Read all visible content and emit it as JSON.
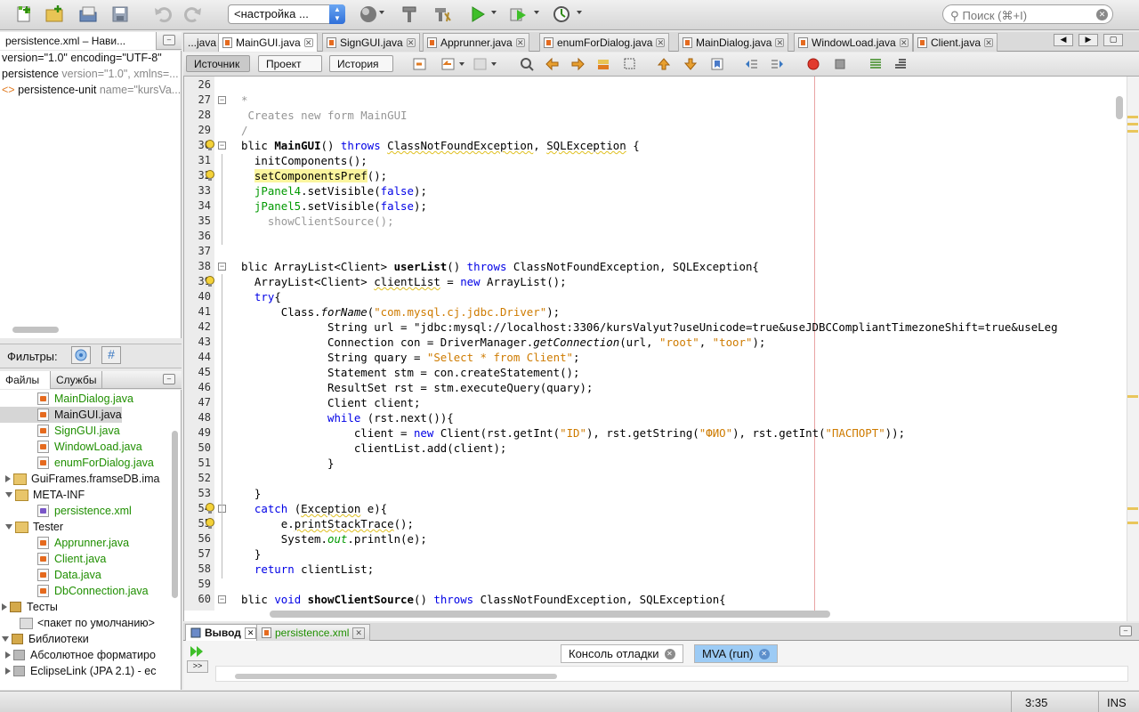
{
  "toolbar": {
    "config_label": "<настройка ...",
    "search_placeholder": "Поиск (⌘+I)",
    "icons": [
      "new-file-icon",
      "new-project-icon",
      "open-project-icon",
      "save-all-icon",
      "undo-icon",
      "redo-icon",
      "globe-icon",
      "hammer-icon",
      "clean-build-icon",
      "run-icon",
      "debug-icon",
      "profile-icon"
    ]
  },
  "navigator": {
    "title": "persistence.xml – Нави...",
    "lines": [
      {
        "text": "version=\"1.0\" encoding=\"UTF-8\"",
        "attr": ""
      },
      {
        "text": "persistence",
        "attr": " version=\"1.0\", xmlns=..."
      },
      {
        "text": "persistence-unit",
        "attr": " name=\"kursVa..."
      }
    ]
  },
  "filters": {
    "label": "Фильтры:"
  },
  "files_panel": {
    "tabs": [
      "Файлы",
      "Службы"
    ],
    "rows": [
      {
        "label": "MainDialog.java",
        "kind": "java",
        "indent": 42,
        "green": true
      },
      {
        "label": "MainGUI.java",
        "kind": "java",
        "indent": 42,
        "green": false,
        "selected": true
      },
      {
        "label": "SignGUI.java",
        "kind": "java",
        "indent": 42,
        "green": true
      },
      {
        "label": "WindowLoad.java",
        "kind": "java",
        "indent": 42,
        "green": true
      },
      {
        "label": "enumForDialog.java",
        "kind": "java",
        "indent": 42,
        "green": true
      },
      {
        "label": "GuiFrames.framseDB.ima",
        "kind": "package",
        "indent": 4,
        "green": false,
        "toggle": "closed"
      },
      {
        "label": "META-INF",
        "kind": "package",
        "indent": 4,
        "green": false,
        "toggle": "open"
      },
      {
        "label": "persistence.xml",
        "kind": "xml",
        "indent": 42,
        "green": true
      },
      {
        "label": "Tester",
        "kind": "package",
        "indent": 4,
        "green": false,
        "toggle": "open"
      },
      {
        "label": "Apprunner.java",
        "kind": "java",
        "indent": 42,
        "green": true
      },
      {
        "label": "Client.java",
        "kind": "java",
        "indent": 42,
        "green": true
      },
      {
        "label": "Data.java",
        "kind": "java",
        "indent": 42,
        "green": true
      },
      {
        "label": "DbConnection.java",
        "kind": "java",
        "indent": 42,
        "green": true
      },
      {
        "label": "Тесты",
        "kind": "folder",
        "indent": 0,
        "green": false,
        "toggle": "closed"
      },
      {
        "label": "<пакет по умолчанию>",
        "kind": "package-empty",
        "indent": 22,
        "green": false
      },
      {
        "label": "Библиотеки",
        "kind": "folder",
        "indent": 0,
        "green": false,
        "toggle": "open"
      },
      {
        "label": "Абсолютное форматиро",
        "kind": "lib",
        "indent": 4,
        "green": false,
        "toggle": "closed"
      },
      {
        "label": "EclipseLink (JPA 2.1) - ec",
        "kind": "lib",
        "indent": 4,
        "green": false,
        "toggle": "closed"
      }
    ]
  },
  "editor": {
    "tabs": [
      {
        "label": "...java",
        "active": false
      },
      {
        "label": "MainGUI.java",
        "active": true
      },
      {
        "label": "SignGUI.java",
        "active": false
      },
      {
        "label": "Apprunner.java",
        "active": false
      },
      {
        "label": "enumForDialog.java",
        "active": false
      },
      {
        "label": "MainDialog.java",
        "active": false
      },
      {
        "label": "WindowLoad.java",
        "active": false
      },
      {
        "label": "Client.java",
        "active": false
      }
    ],
    "views": [
      "Источник",
      "Проект",
      "История"
    ],
    "lines": [
      {
        "n": "26",
        "t": ""
      },
      {
        "n": "27",
        "t": "*"
      },
      {
        "n": "28",
        "t": " Creates new form MainGUI"
      },
      {
        "n": "29",
        "t": "/"
      },
      {
        "n": "30",
        "t": "blic MainGUI() throws ClassNotFoundException, SQLException {"
      },
      {
        "n": "31",
        "t": "  initComponents();"
      },
      {
        "n": "32",
        "t": "  setComponentsPref();"
      },
      {
        "n": "33",
        "t": "  jPanel4.setVisible(false);"
      },
      {
        "n": "34",
        "t": "  jPanel5.setVisible(false);"
      },
      {
        "n": "35",
        "t": "    showClientSource();"
      },
      {
        "n": "36",
        "t": ""
      },
      {
        "n": "37",
        "t": ""
      },
      {
        "n": "38",
        "t": "blic ArrayList<Client> userList() throws ClassNotFoundException, SQLException{"
      },
      {
        "n": "39",
        "t": "  ArrayList<Client> clientList = new ArrayList();"
      },
      {
        "n": "40",
        "t": "  try{"
      },
      {
        "n": "41",
        "t": "      Class.forName(\"com.mysql.cj.jdbc.Driver\");"
      },
      {
        "n": "42",
        "t": "             String url = \"jdbc:mysql://localhost:3306/kursValyut?useUnicode=true&useJDBCCompliantTimezoneShift=true&useLeg"
      },
      {
        "n": "43",
        "t": "             Connection con = DriverManager.getConnection(url, \"root\", \"toor\");"
      },
      {
        "n": "44",
        "t": "             String quary = \"Select * from Client\";"
      },
      {
        "n": "45",
        "t": "             Statement stm = con.createStatement();"
      },
      {
        "n": "46",
        "t": "             ResultSet rst = stm.executeQuery(quary);"
      },
      {
        "n": "47",
        "t": "             Client client;"
      },
      {
        "n": "48",
        "t": "             while (rst.next()){"
      },
      {
        "n": "49",
        "t": "                 client = new Client(rst.getInt(\"ID\"), rst.getString(\"ФИО\"), rst.getInt(\"ПАСПОРТ\"));"
      },
      {
        "n": "50",
        "t": "                 clientList.add(client);"
      },
      {
        "n": "51",
        "t": "             }"
      },
      {
        "n": "52",
        "t": ""
      },
      {
        "n": "53",
        "t": "  }"
      },
      {
        "n": "54",
        "t": "  catch (Exception e){"
      },
      {
        "n": "55",
        "t": "      e.printStackTrace();"
      },
      {
        "n": "56",
        "t": "      System.out.println(e);"
      },
      {
        "n": "57",
        "t": "  }"
      },
      {
        "n": "58",
        "t": "  return clientList;"
      },
      {
        "n": "59",
        "t": ""
      },
      {
        "n": "60",
        "t": "blic void showClientSource() throws ClassNotFoundException, SQLException{"
      }
    ]
  },
  "output": {
    "tabs": [
      {
        "label": "Вывод",
        "active": true
      },
      {
        "label": "persistence.xml",
        "active": false
      }
    ],
    "consoles": [
      {
        "label": "Консоль отладки",
        "active": false
      },
      {
        "label": "MVA (run)",
        "active": true
      }
    ]
  },
  "status": {
    "position": "3:35",
    "mode": "INS"
  }
}
